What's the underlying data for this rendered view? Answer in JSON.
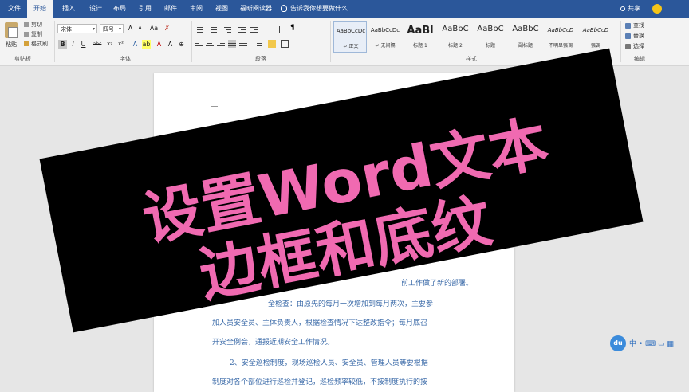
{
  "tabs": [
    {
      "label": "文件",
      "active": false
    },
    {
      "label": "开始",
      "active": true
    },
    {
      "label": "插入",
      "active": false
    },
    {
      "label": "设计",
      "active": false
    },
    {
      "label": "布局",
      "active": false
    },
    {
      "label": "引用",
      "active": false
    },
    {
      "label": "邮件",
      "active": false
    },
    {
      "label": "审阅",
      "active": false
    },
    {
      "label": "视图",
      "active": false
    },
    {
      "label": "福昕阅读器",
      "active": false
    }
  ],
  "tellme": "告诉我你想要做什么",
  "share": "共享",
  "ribbon": {
    "clipboard": {
      "paste": "粘贴",
      "cut": "剪切",
      "copy": "复制",
      "format_painter": "格式刷",
      "label": "剪贴板"
    },
    "font": {
      "name": "宋体",
      "size": "四号",
      "label": "字体",
      "grow": "A",
      "shrink": "A",
      "change_case": "Aa",
      "bold": "B",
      "italic": "I",
      "underline": "U",
      "strike": "abc",
      "subscript": "x₂",
      "superscript": "x²"
    },
    "paragraph": {
      "label": "段落"
    },
    "styles": {
      "label": "样式",
      "items": [
        {
          "sample": "AaBbCcDc",
          "name": "↵ 正文",
          "big": false,
          "selected": true
        },
        {
          "sample": "AaBbCcDc",
          "name": "↵ 无间隔",
          "big": false,
          "selected": false
        },
        {
          "sample": "AaBl",
          "name": "标题 1",
          "big": true,
          "selected": false
        },
        {
          "sample": "AaBbC",
          "name": "标题 2",
          "big": true,
          "selected": false
        },
        {
          "sample": "AaBbC",
          "name": "标题",
          "big": true,
          "selected": false
        },
        {
          "sample": "AaBbC",
          "name": "副标题",
          "big": true,
          "selected": false
        },
        {
          "sample": "AaBbCcD",
          "name": "不明显强调",
          "big": false,
          "selected": false
        },
        {
          "sample": "AaBbCcD",
          "name": "强调",
          "big": false,
          "selected": false
        }
      ]
    },
    "editing": {
      "find": "查找",
      "replace": "替换",
      "select": "选择",
      "label": "编辑"
    }
  },
  "document": {
    "lines": [
      "前工作做了新的部署。",
      "全检查：由原先的每月一次增加到每月两次，主要参",
      "加人员安全员、主体负责人，根据检查情况下达整改指令；每月底召",
      "开安全例会，通报近期安全工作情况。",
      "2、安全巡检制度，现场巡检人员、安全员、管理人员等要根据",
      "制度对各个部位进行巡检并登记，巡检频率较低，不按制度执行的按"
    ]
  },
  "banner": {
    "line1": "设置Word文本",
    "line2": "边框和底纹"
  },
  "ime": {
    "logo": "du",
    "lang": "中"
  },
  "colors": {
    "tabbar": "#2b579a",
    "banner_text": "#f06ab1",
    "banner_bg": "#000000",
    "doc_text": "#3a6aa8"
  }
}
